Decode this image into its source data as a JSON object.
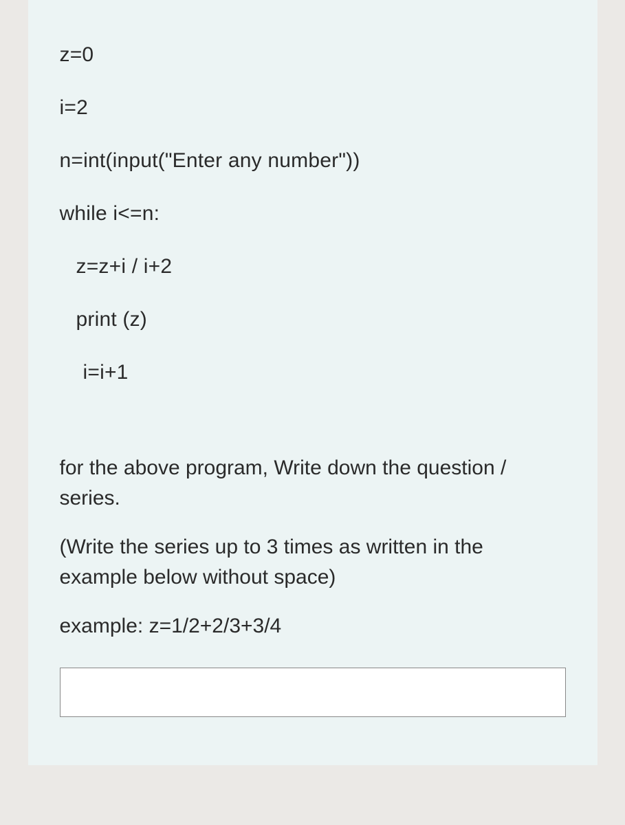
{
  "code": {
    "line1": "z=0",
    "line2": "i=2",
    "line3": "n=int(input(\"Enter any number\"))",
    "line4": "while i<=n:",
    "line5": "z=z+i / i+2",
    "line6": "print (z)",
    "line7": "i=i+1"
  },
  "instructions": {
    "para1": "for the above program, Write down the question / series.",
    "para2": "(Write the series up to 3 times as written in the example below without space)",
    "para3": "example:  z=1/2+2/3+3/4"
  },
  "answer": {
    "value": ""
  }
}
